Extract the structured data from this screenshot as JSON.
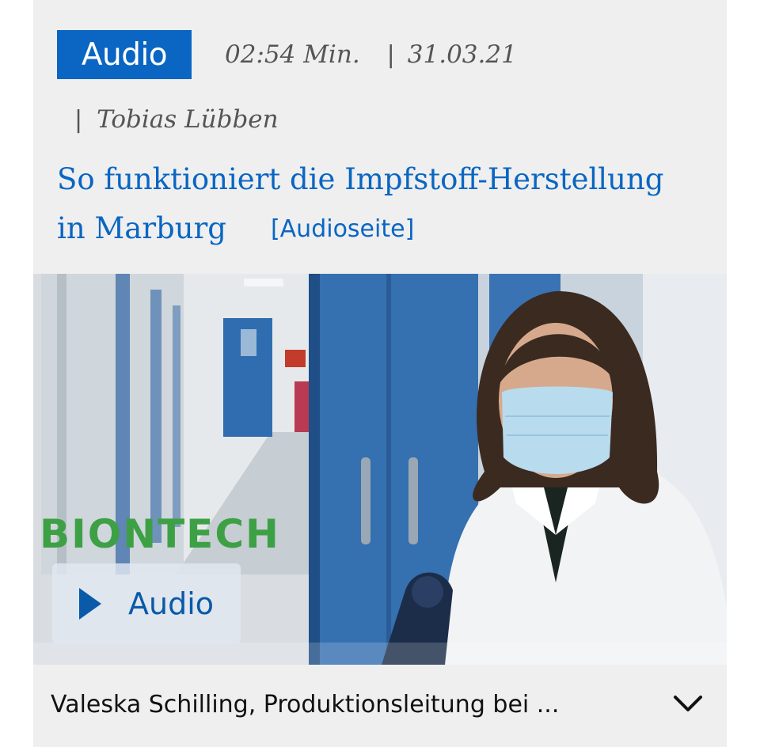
{
  "article": {
    "badge_label": "Audio",
    "duration": "02:54 Min.",
    "separator": "|",
    "date": "31.03.21",
    "author": "Tobias Lübben",
    "headline": "So funktioniert die Impfstoff-Herstellung in Marburg",
    "audio_page_link": "[Audioseite]"
  },
  "media": {
    "logo_text": "BIONTECH",
    "play_button_label": "Audio",
    "play_icon": "play-icon"
  },
  "caption": {
    "text": "Valeska Schilling, Produktionsleitung bei ...",
    "expand_icon": "chevron-down-icon"
  },
  "colors": {
    "accent": "#0a66c2",
    "background": "#efefef",
    "logo_green": "#3ea045"
  }
}
